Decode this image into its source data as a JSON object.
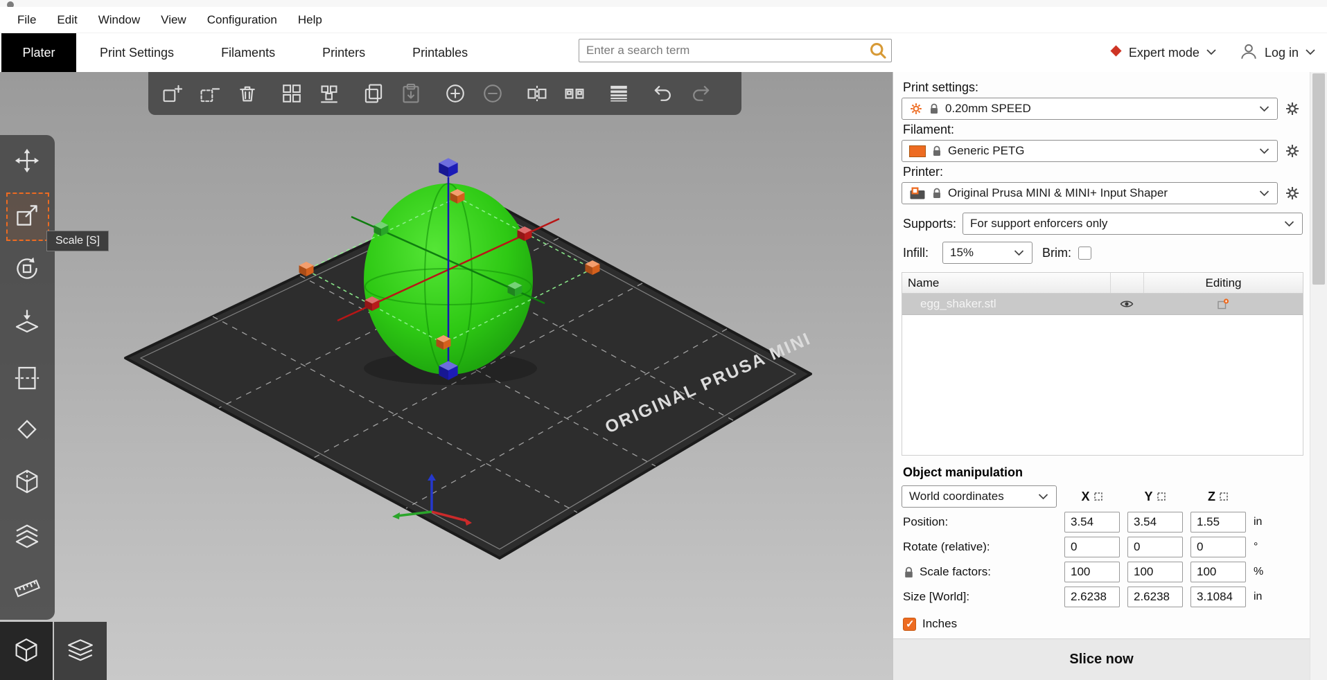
{
  "menu": {
    "items": [
      "File",
      "Edit",
      "Window",
      "View",
      "Configuration",
      "Help"
    ]
  },
  "tabbar": {
    "tabs": [
      {
        "label": "Plater",
        "active": true
      },
      {
        "label": "Print Settings",
        "active": false
      },
      {
        "label": "Filaments",
        "active": false
      },
      {
        "label": "Printers",
        "active": false
      },
      {
        "label": "Printables",
        "active": false
      }
    ],
    "search": {
      "placeholder": "Enter a search term"
    },
    "mode": {
      "label": "Expert mode"
    },
    "account": {
      "label": "Log in"
    }
  },
  "viewport": {
    "tooltip": "Scale [S]",
    "bed_label": "ORIGINAL PRUSA MINI",
    "top_toolbar_icons": [
      "add-object",
      "remove-object",
      "delete-all-objects",
      "arrange",
      "arrange-current-bed",
      "copy",
      "paste",
      "add-instance",
      "remove-instance",
      "split-to-objects",
      "split-to-parts",
      "variable-layer-height",
      "undo",
      "redo"
    ],
    "left_toolbar_icons": [
      "move",
      "scale",
      "rotate",
      "place-on-face",
      "cut",
      "paint-supports",
      "seam-painting",
      "emboss",
      "measure"
    ],
    "selected_tool": "scale",
    "view_modes": [
      "3d-editor",
      "layers-preview"
    ]
  },
  "panel": {
    "print_settings": {
      "label": "Print settings:",
      "value": "0.20mm SPEED"
    },
    "filament": {
      "label": "Filament:",
      "value": "Generic PETG",
      "swatch_color": "#ED6B21"
    },
    "printer": {
      "label": "Printer:",
      "value": "Original Prusa MINI & MINI+ Input Shaper"
    },
    "supports": {
      "label": "Supports:",
      "value": "For support enforcers only"
    },
    "infill": {
      "label": "Infill:",
      "value": "15%"
    },
    "brim": {
      "label": "Brim:",
      "checked": false
    },
    "object_list": {
      "name_header": "Name",
      "editing_header": "Editing",
      "rows": [
        {
          "name": "egg_shaker.stl"
        }
      ]
    },
    "manipulation": {
      "title": "Object manipulation",
      "coordinate_system": "World coordinates",
      "axes": [
        "X",
        "Y",
        "Z"
      ],
      "rows": [
        {
          "label": "Position:",
          "x": "3.54",
          "y": "3.54",
          "z": "1.55",
          "unit": "in"
        },
        {
          "label": "Rotate (relative):",
          "x": "0",
          "y": "0",
          "z": "0",
          "unit": "°"
        },
        {
          "label": "Scale factors:",
          "x": "100",
          "y": "100",
          "z": "100",
          "unit": "%"
        },
        {
          "label": "Size [World]:",
          "x": "2.6238",
          "y": "2.6238",
          "z": "3.1084",
          "unit": "in"
        }
      ],
      "inches": {
        "label": "Inches",
        "checked": true
      }
    },
    "slice_button": "Slice now"
  },
  "colors": {
    "accent": "#ED6B21",
    "object_green": "#2ec914"
  }
}
